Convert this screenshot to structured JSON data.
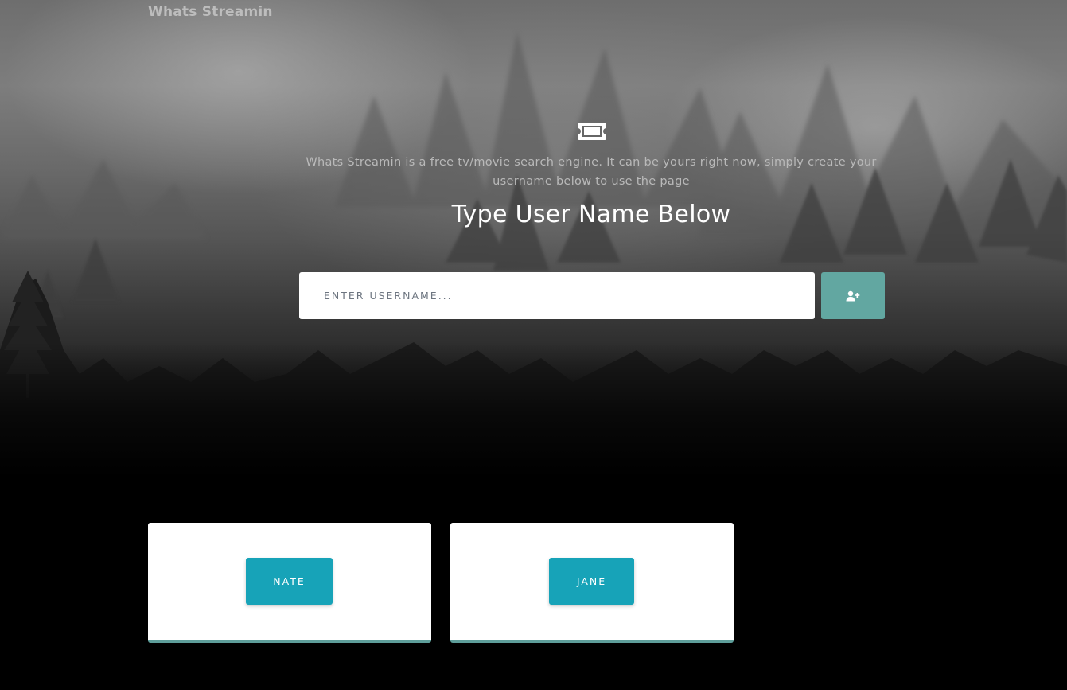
{
  "brand": {
    "title": "Whats Streamin"
  },
  "hero": {
    "icon": "ticket-icon",
    "tagline": "Whats Streamin is a free tv/movie search engine. It can be yours right now, simply create your username below to use the page",
    "headline": "Type User Name Below"
  },
  "search": {
    "placeholder": "ENTER USERNAME...",
    "value": "",
    "add_button_icon": "add-user-icon"
  },
  "users": [
    {
      "label": "NATE"
    },
    {
      "label": "JANE"
    }
  ],
  "colors": {
    "accent_button": "#62a7a1",
    "user_button": "#17a3b8",
    "card_border": "#5e9e9a",
    "background": "#000000"
  }
}
